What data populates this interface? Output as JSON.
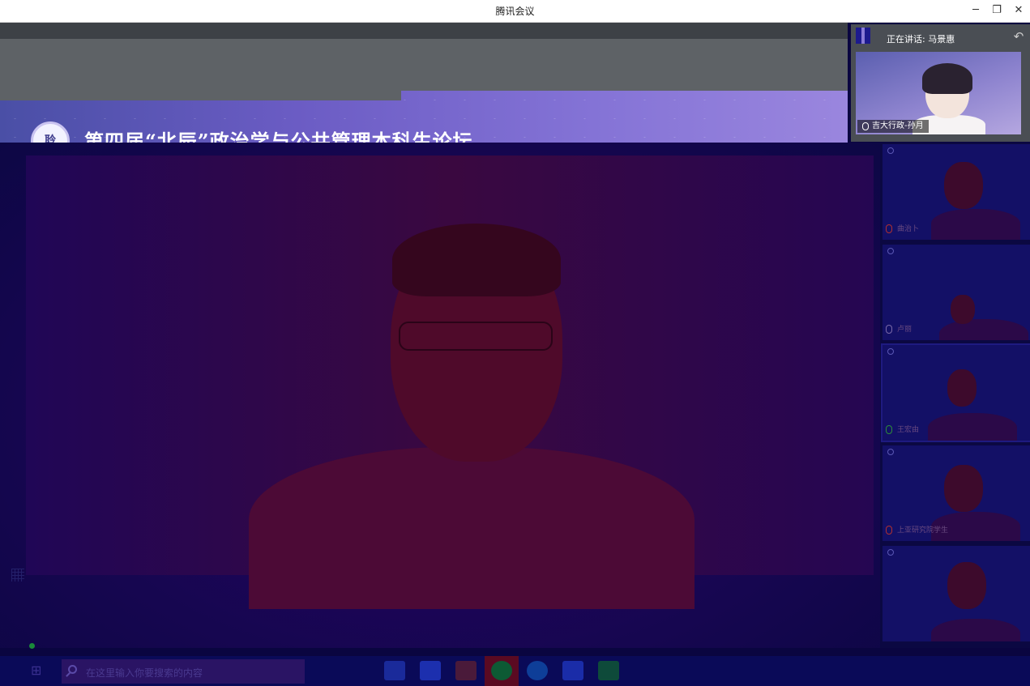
{
  "window": {
    "title": "腾讯会议"
  },
  "share": {
    "banner_logo_text": "聆",
    "banner_title": "第四届“北辰”政治学与公共管理本科生论坛"
  },
  "speaking": {
    "label": "正在讲话: 马景惠",
    "thumb_name": "吉大行政-孙月"
  },
  "participants": [
    {
      "name": "曲治卜",
      "mic": "muted"
    },
    {
      "name": "卢丽",
      "mic": "off"
    },
    {
      "name": "王宏由",
      "mic": "on"
    },
    {
      "name": "上亚研究院学生",
      "mic": "muted"
    },
    {
      "name": "",
      "mic": "muted"
    }
  ],
  "taskbar": {
    "search_placeholder": "在这里输入你要搜索的内容"
  },
  "colors": {
    "accent": "#6b5cc4",
    "background": "#0a0540"
  }
}
